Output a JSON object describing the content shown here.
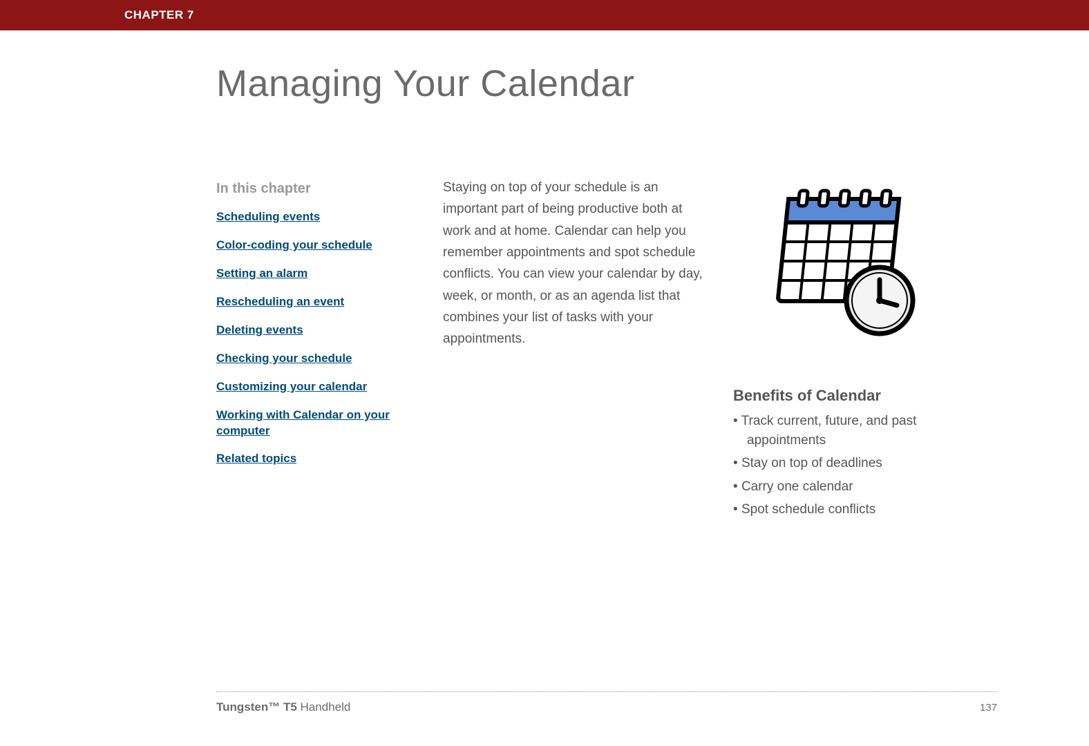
{
  "header": {
    "chapter_label": "CHAPTER 7"
  },
  "title": "Managing Your Calendar",
  "sidebar": {
    "heading": "In this chapter",
    "items": [
      {
        "label": "Scheduling events"
      },
      {
        "label": "Color-coding your schedule"
      },
      {
        "label": "Setting an alarm"
      },
      {
        "label": "Rescheduling an event"
      },
      {
        "label": "Deleting events"
      },
      {
        "label": "Checking your schedule"
      },
      {
        "label": "Customizing your calendar"
      },
      {
        "label": "Working with Calendar on your computer"
      },
      {
        "label": "Related topics"
      }
    ]
  },
  "intro": "Staying on top of your schedule is an important part of being productive both at work and at home. Calendar can help you remember appointments and spot schedule conflicts. You can view your calendar by day, week, or month, or as an agenda list that combines your list of tasks with your appointments.",
  "illustration": {
    "name": "calendar-clock-icon"
  },
  "benefits": {
    "heading": "Benefits of Calendar",
    "items": [
      "Track current, future, and past appointments",
      "Stay on top of deadlines",
      "Carry one calendar",
      "Spot schedule conflicts"
    ]
  },
  "footer": {
    "product_bold": "Tungsten™ T5",
    "product_rest": " Handheld",
    "page_number": "137"
  }
}
